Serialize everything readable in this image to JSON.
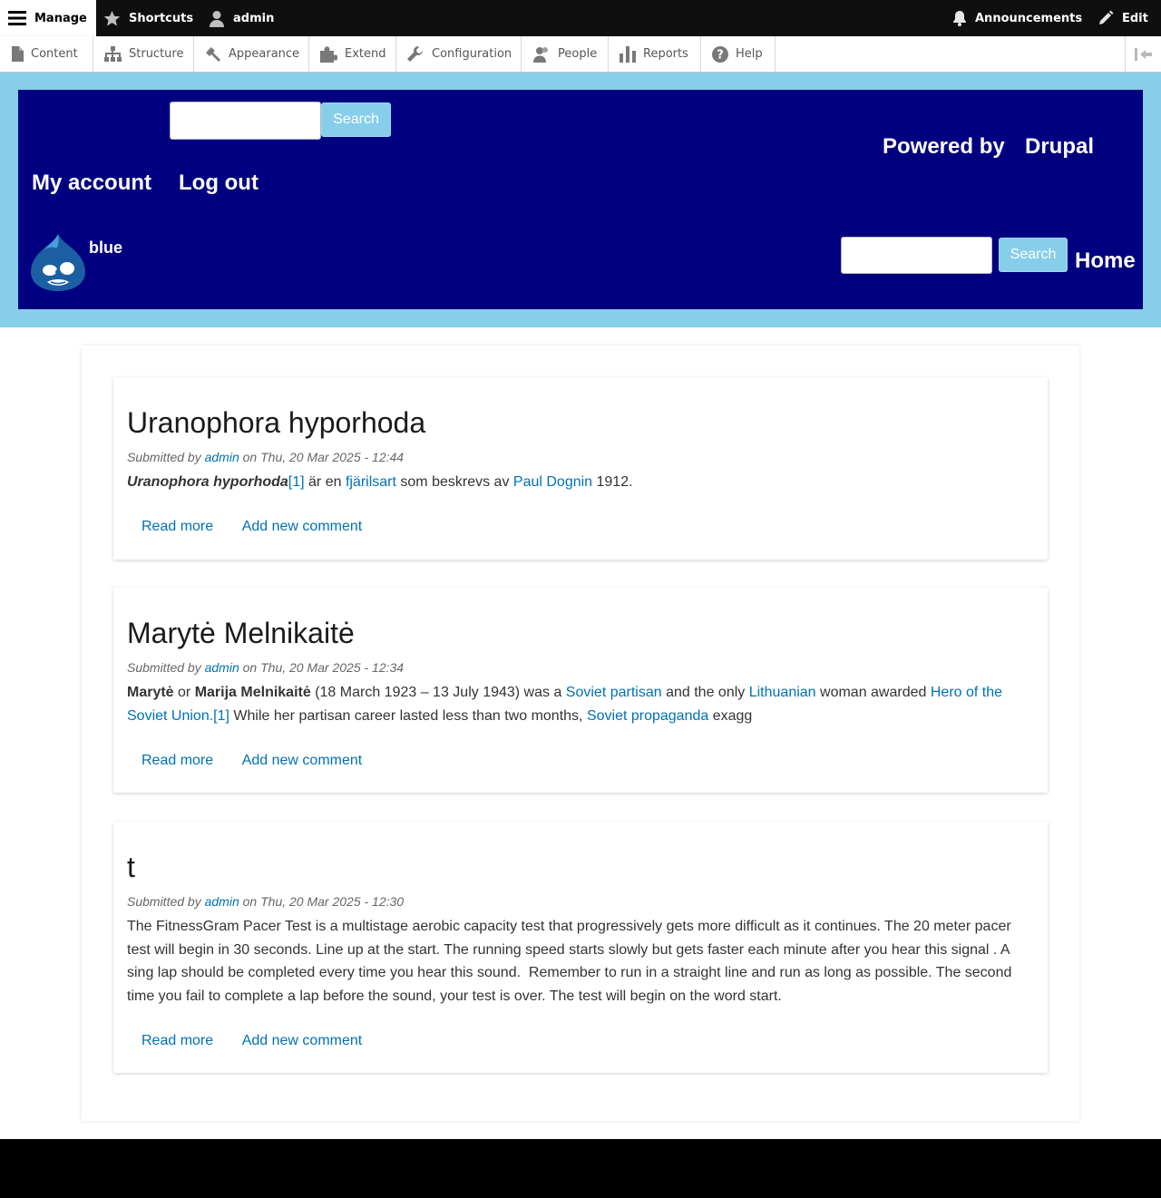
{
  "toolbar": {
    "manage": "Manage",
    "shortcuts": "Shortcuts",
    "user": "admin",
    "announcements": "Announcements",
    "edit": "Edit"
  },
  "tray": {
    "items": [
      "Content",
      "Structure",
      "Appearance",
      "Extend",
      "Configuration",
      "People",
      "Reports",
      "Help"
    ]
  },
  "header": {
    "search_button_label": "Search",
    "powered_by": "Powered by",
    "drupal": "Drupal",
    "my_account": "My account",
    "log_out": "Log out",
    "site_name": "blue",
    "home": "Home",
    "colors": {
      "outer": "#87ceeb",
      "inner": "#000080"
    }
  },
  "articles": [
    {
      "title": "Uranophora hyporhoda",
      "meta_prefix": "Submitted by",
      "author": "admin",
      "meta_suffix": "on Thu, 20 Mar 2025 - 12:44",
      "body": {
        "bold_italic": "Uranophora hyporhoda",
        "ref": "[1]",
        "t1": " är en ",
        "link1": "fjärilsart",
        "t2": " som beskrevs av ",
        "link2": "Paul Dognin",
        "t3": " 1912."
      },
      "read_more": "Read more",
      "add_comment": "Add new comment"
    },
    {
      "title": "Marytė Melnikaitė",
      "meta_prefix": "Submitted by",
      "author": "admin",
      "meta_suffix": "on Thu, 20 Mar 2025 - 12:34",
      "body": {
        "bold1": "Marytė",
        "t1": " or ",
        "bold2": "Marija Melnikaitė",
        "t2": " (18 March 1923 – 13 July 1943) was a ",
        "link1": "Soviet partisan",
        "t3": " and the only ",
        "link2": "Lithuanian",
        "t4": " woman awarded ",
        "link3": "Hero of the Soviet Union",
        "t5": ".",
        "ref": "[1]",
        "t6": " While her partisan career lasted less than two months, ",
        "link4": "Soviet propaganda",
        "t7": " exagg"
      },
      "read_more": "Read more",
      "add_comment": "Add new comment"
    },
    {
      "title": "t",
      "meta_prefix": "Submitted by",
      "author": "admin",
      "meta_suffix": "on Thu, 20 Mar 2025 - 12:30",
      "body": {
        "text": "The FitnessGram Pacer Test is a multistage aerobic capacity test that progressively gets more difficult as it continues. The 20 meter pacer test will begin in 30 seconds. Line up at the start. The running speed starts slowly but gets faster each minute after you hear this signal . A sing lap should be completed every time you hear this sound.  Remember to run in a straight line and run as long as possible. The second time you fail to complete a lap before the sound, your test is over. The test will begin on the word start."
      },
      "read_more": "Read more",
      "add_comment": "Add new comment"
    }
  ]
}
